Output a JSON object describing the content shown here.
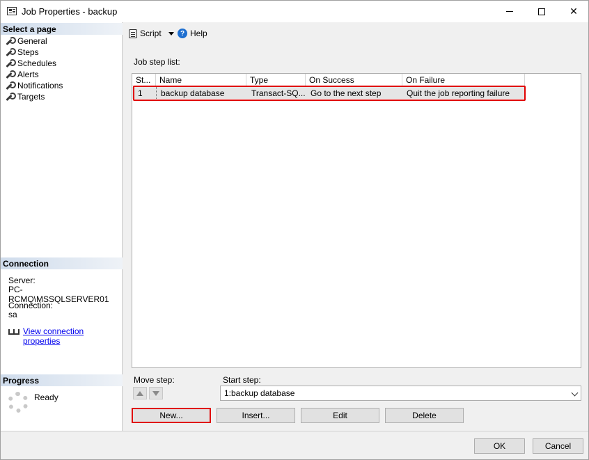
{
  "window": {
    "title": "Job Properties - backup"
  },
  "left": {
    "select_header": "Select a page",
    "pages": [
      "General",
      "Steps",
      "Schedules",
      "Alerts",
      "Notifications",
      "Targets"
    ],
    "connection_header": "Connection",
    "server_label": "Server:",
    "server_value": "PC-RCMQ\\MSSQLSERVER01",
    "connection_label": "Connection:",
    "connection_value": "sa",
    "view_link": "View connection properties",
    "progress_header": "Progress",
    "progress_status": "Ready"
  },
  "toolbar": {
    "script_label": "Script",
    "help_label": "Help"
  },
  "main": {
    "list_label": "Job step list:",
    "columns": [
      "St...",
      "Name",
      "Type",
      "On Success",
      "On Failure"
    ],
    "rows": [
      {
        "step": "1",
        "name": "backup database",
        "type": "Transact-SQ...",
        "on_success": "Go to the next step",
        "on_failure": "Quit the job reporting failure"
      }
    ],
    "move_step_label": "Move step:",
    "start_step_label": "Start step:",
    "start_step_value": "1:backup database",
    "buttons": {
      "new": "New...",
      "insert": "Insert...",
      "edit": "Edit",
      "delete": "Delete"
    }
  },
  "footer": {
    "ok": "OK",
    "cancel": "Cancel"
  },
  "colors": {
    "highlight": "#e00000",
    "link": "#0000ee",
    "help_icon": "#1e6fd0"
  }
}
